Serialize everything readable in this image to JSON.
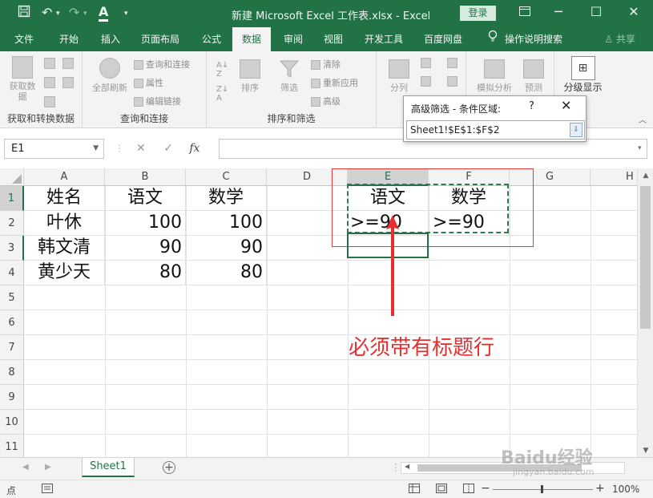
{
  "titlebar": {
    "title": "新建 Microsoft Excel 工作表.xlsx  -  Excel",
    "login": "登录",
    "save_icon": "save-icon",
    "undo_icon": "undo-icon",
    "redo_icon": "redo-icon",
    "font_color_icon": "font-color-icon"
  },
  "tabs": [
    "文件",
    "开始",
    "插入",
    "页面布局",
    "公式",
    "数据",
    "审阅",
    "视图",
    "开发工具",
    "百度网盘",
    "操作说明搜索"
  ],
  "active_tab": "数据",
  "share": "共享",
  "ribbon": {
    "groups": {
      "get_transform": "获取和转换数据",
      "query_connect": "查询和连接",
      "sort_filter": "排序和筛选"
    },
    "get_data": "获取数\n据",
    "refresh_all": "全部刷新",
    "queries_connections": "查询和连接",
    "properties": "属性",
    "edit_links": "编辑链接",
    "sort": "排序",
    "filter": "筛选",
    "clear": "清除",
    "reapply": "重新应用",
    "advanced": "高级",
    "split": "分列",
    "whatif": "模拟分析",
    "forecast": "预测",
    "outline": "分级显示"
  },
  "formula_bar": {
    "name_box": "E1",
    "cancel": "✕",
    "enter": "✓",
    "fx": "fx",
    "value": ""
  },
  "grid": {
    "columns": [
      "A",
      "B",
      "C",
      "D",
      "E",
      "F",
      "G",
      "H"
    ],
    "rows": [
      "1",
      "2",
      "3",
      "4",
      "5",
      "6",
      "7",
      "8",
      "9",
      "10",
      "11"
    ],
    "cells": {
      "A1": "姓名",
      "B1": "语文",
      "C1": "数学",
      "A2": "叶休",
      "B2": "100",
      "C2": "100",
      "A3": "韩文清",
      "B3": "90",
      "C3": "90",
      "A4": "黄少天",
      "B4": "80",
      "C4": "80",
      "E1": "语文",
      "F1": "数学",
      "E2": ">=90",
      "F2": ">=90"
    }
  },
  "sheets": [
    "Sheet1"
  ],
  "status": {
    "mode": "点",
    "zoom": "100%"
  },
  "dialog": {
    "title": "高级筛选 - 条件区域:",
    "help": "?",
    "close": "✕",
    "value": "Sheet1!$E$1:$F$2"
  },
  "annotation": "必须带有标题行",
  "watermark": "Baidu经验",
  "watermark_url": "jingyan.baidu.com",
  "colors": {
    "excel_green": "#217346",
    "annotation_red": "#e63030"
  }
}
